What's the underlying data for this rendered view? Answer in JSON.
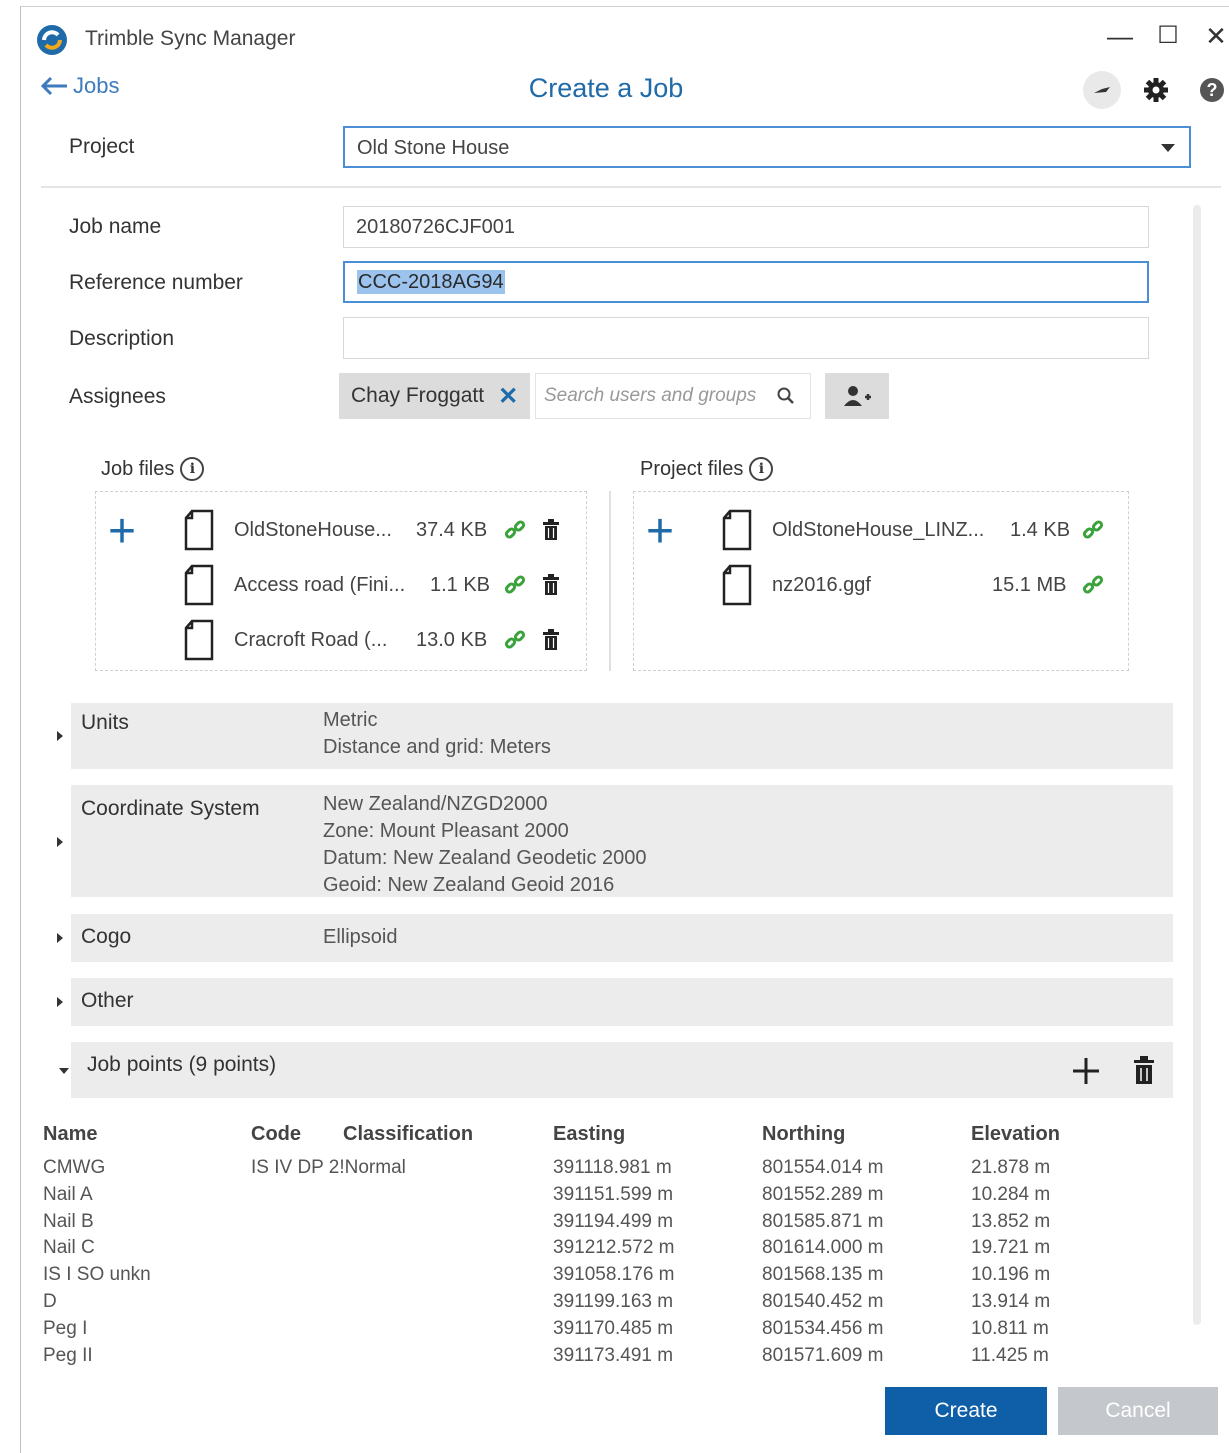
{
  "window": {
    "title": "Trimble Sync Manager",
    "minimize": "—",
    "maximize": "☐",
    "close": "✕"
  },
  "header": {
    "back_label": "Jobs",
    "title": "Create a Job"
  },
  "form": {
    "project_label": "Project",
    "project_value": "Old Stone House",
    "job_name_label": "Job name",
    "job_name_value": "20180726CJF001",
    "reference_label": "Reference number",
    "reference_value": "CCC-2018AG94",
    "description_label": "Description",
    "description_value": "",
    "assignees_label": "Assignees",
    "assignee_chip": "Chay Froggatt",
    "search_placeholder": "Search users and groups"
  },
  "job_files": {
    "title": "Job files",
    "files": [
      {
        "name": "OldStoneHouse...",
        "size": "37.4 KB"
      },
      {
        "name": "Access road (Fini...",
        "size": "1.1 KB"
      },
      {
        "name": "Cracroft Road (...",
        "size": "13.0 KB"
      }
    ]
  },
  "project_files": {
    "title": "Project files",
    "files": [
      {
        "name": "OldStoneHouse_LINZ...",
        "size": "1.4 KB"
      },
      {
        "name": "nz2016.ggf",
        "size": "15.1 MB"
      }
    ]
  },
  "sections": {
    "units": {
      "title": "Units",
      "lines": [
        "Metric",
        "Distance and grid: Meters"
      ]
    },
    "coordinate_system": {
      "title": "Coordinate System",
      "lines": [
        "New Zealand/NZGD2000",
        "Zone: Mount Pleasant 2000",
        "Datum: New Zealand Geodetic 2000",
        "Geoid: New Zealand Geoid 2016"
      ]
    },
    "cogo": {
      "title": "Cogo",
      "lines": [
        "Ellipsoid"
      ]
    },
    "other": {
      "title": "Other"
    },
    "job_points": {
      "title": "Job points (9 points)"
    }
  },
  "points_table": {
    "headers": {
      "name": "Name",
      "code": "Code",
      "classification": "Classification",
      "easting": "Easting",
      "northing": "Northing",
      "elevation": "Elevation"
    },
    "rows": [
      {
        "name": "CMWG",
        "code": "IS IV DP 2!",
        "classification": "Normal",
        "easting": "391118.981 m",
        "northing": "801554.014 m",
        "elevation": "21.878 m"
      },
      {
        "name": "Nail A",
        "code": "",
        "classification": "",
        "easting": "391151.599 m",
        "northing": "801552.289 m",
        "elevation": "10.284 m"
      },
      {
        "name": "Nail B",
        "code": "",
        "classification": "",
        "easting": "391194.499 m",
        "northing": "801585.871 m",
        "elevation": "13.852 m"
      },
      {
        "name": "Nail C",
        "code": "",
        "classification": "",
        "easting": "391212.572 m",
        "northing": "801614.000 m",
        "elevation": "19.721 m"
      },
      {
        "name": "IS I SO unkn",
        "code": "",
        "classification": "",
        "easting": "391058.176 m",
        "northing": "801568.135 m",
        "elevation": "10.196 m"
      },
      {
        "name": "D",
        "code": "",
        "classification": "",
        "easting": "391199.163 m",
        "northing": "801540.452 m",
        "elevation": "13.914 m"
      },
      {
        "name": "Peg I",
        "code": "",
        "classification": "",
        "easting": "391170.485 m",
        "northing": "801534.456 m",
        "elevation": "10.811 m"
      },
      {
        "name": "Peg II",
        "code": "",
        "classification": "",
        "easting": "391173.491 m",
        "northing": "801571.609 m",
        "elevation": "11.425 m"
      }
    ]
  },
  "buttons": {
    "create": "Create",
    "cancel": "Cancel"
  },
  "colors": {
    "accent": "#1f6aa8",
    "primary_button": "#0e5fa8",
    "link_green": "#3aa23a",
    "section_bg": "#ececec"
  },
  "icons": [
    "app-logo-icon",
    "back-arrow-icon",
    "sync-icon",
    "gear-icon",
    "help-icon",
    "search-icon",
    "add-user-icon",
    "info-icon",
    "file-icon",
    "link-icon",
    "trash-icon",
    "plus-icon"
  ]
}
